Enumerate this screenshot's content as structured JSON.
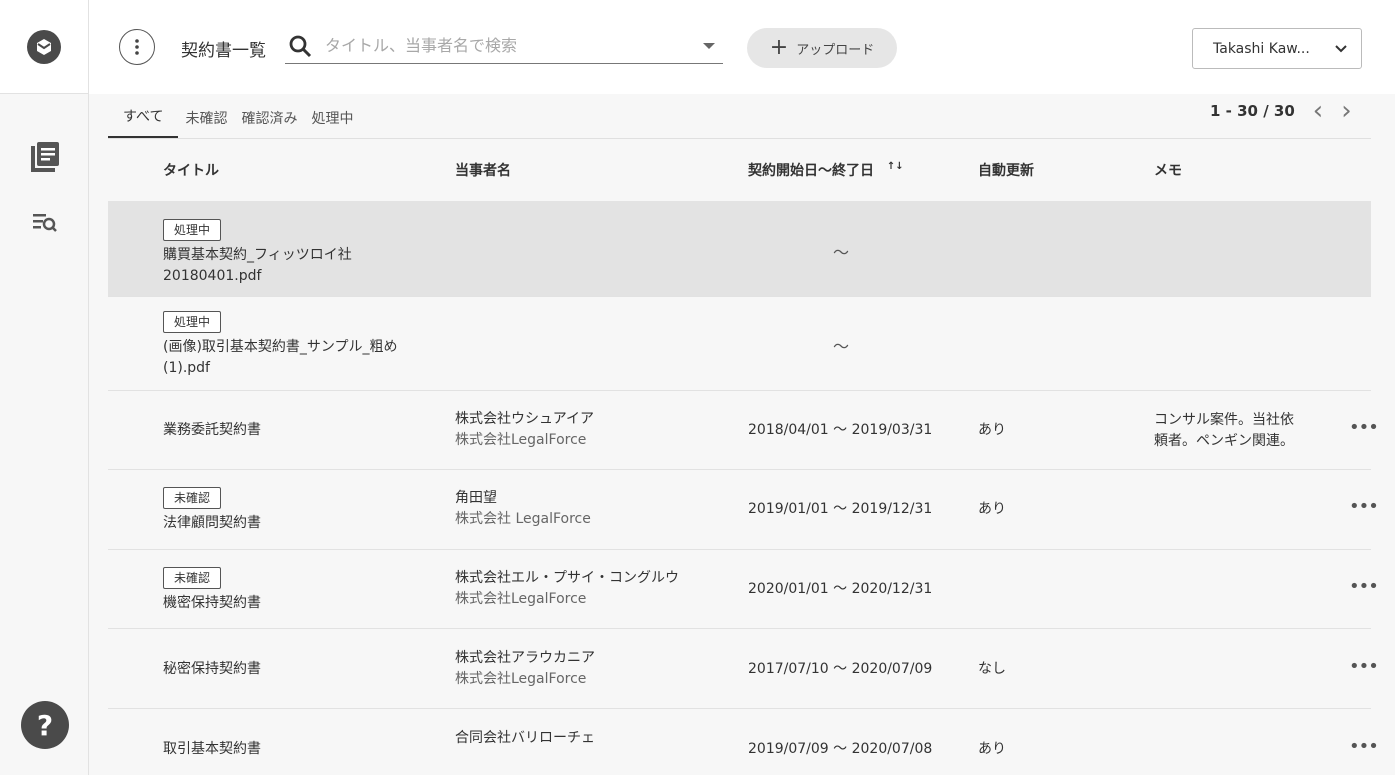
{
  "header": {
    "title": "契約書一覧",
    "search_placeholder": "タイトル、当事者名で検索",
    "upload_label": "アップロード",
    "user_name": "Takashi Kaw..."
  },
  "tabs": [
    "すべて",
    "未確認",
    "確認済み",
    "処理中"
  ],
  "pager": {
    "range": "1 - 30 / 30"
  },
  "columns": {
    "title": "タイトル",
    "party": "当事者名",
    "date": "契約開始日〜終了日",
    "auto": "自動更新",
    "memo": "メモ"
  },
  "rows": [
    {
      "badge": "処理中",
      "title1": "購買基本契約_フィッツロイ社",
      "title2": "20180401.pdf",
      "date": "〜"
    },
    {
      "badge": "処理中",
      "title1": "(画像)取引基本契約書_サンプル_粗め",
      "title2": "(1).pdf",
      "date": "〜"
    },
    {
      "title": "業務委託契約書",
      "party1": "株式会社ウシュアイア",
      "party2": "株式会社LegalForce",
      "date": "2018/04/01 〜 2019/03/31",
      "auto": "あり",
      "memo1": "コンサル案件。当社依",
      "memo2": "頼者。ペンギン関連。",
      "more": "•••"
    },
    {
      "badge": "未確認",
      "title": "法律顧問契約書",
      "party1": "角田望",
      "party2": "株式会社 LegalForce",
      "date": "2019/01/01 〜 2019/12/31",
      "auto": "あり",
      "more": "•••"
    },
    {
      "badge": "未確認",
      "title": "機密保持契約書",
      "party1": "株式会社エル・プサイ・コングルウ",
      "party2": "株式会社LegalForce",
      "date": "2020/01/01 〜 2020/12/31",
      "more": "•••"
    },
    {
      "title": "秘密保持契約書",
      "party1": "株式会社アラウカニア",
      "party2": "株式会社LegalForce",
      "date": "2017/07/10 〜 2020/07/09",
      "auto": "なし",
      "more": "•••"
    },
    {
      "title": "取引基本契約書",
      "party1": "合同会社バリローチェ",
      "date": "2019/07/09 〜 2020/07/08",
      "auto": "あり",
      "more": "•••"
    }
  ],
  "help_label": "?",
  "sort_icon_label": "↑↓"
}
